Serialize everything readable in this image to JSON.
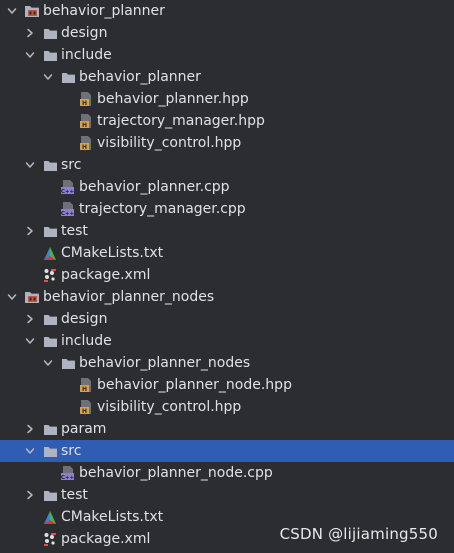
{
  "tree": [
    {
      "label": "behavior_planner",
      "kind": "module",
      "depth": 0,
      "chevron": "down",
      "icon": "module-folder-icon"
    },
    {
      "label": "design",
      "kind": "folder",
      "depth": 1,
      "chevron": "right",
      "icon": "folder-icon"
    },
    {
      "label": "include",
      "kind": "folder",
      "depth": 1,
      "chevron": "down",
      "icon": "folder-icon"
    },
    {
      "label": "behavior_planner",
      "kind": "folder",
      "depth": 2,
      "chevron": "down",
      "icon": "folder-icon"
    },
    {
      "label": "behavior_planner.hpp",
      "kind": "hpp",
      "depth": 3,
      "chevron": "none",
      "icon": "cpp-header-file-icon"
    },
    {
      "label": "trajectory_manager.hpp",
      "kind": "hpp",
      "depth": 3,
      "chevron": "none",
      "icon": "cpp-header-file-icon"
    },
    {
      "label": "visibility_control.hpp",
      "kind": "hpp",
      "depth": 3,
      "chevron": "none",
      "icon": "cpp-header-file-icon"
    },
    {
      "label": "src",
      "kind": "folder",
      "depth": 1,
      "chevron": "down",
      "icon": "folder-icon"
    },
    {
      "label": "behavior_planner.cpp",
      "kind": "cpp",
      "depth": 2,
      "chevron": "none",
      "icon": "cpp-source-file-icon"
    },
    {
      "label": "trajectory_manager.cpp",
      "kind": "cpp",
      "depth": 2,
      "chevron": "none",
      "icon": "cpp-source-file-icon"
    },
    {
      "label": "test",
      "kind": "folder",
      "depth": 1,
      "chevron": "right",
      "icon": "folder-icon"
    },
    {
      "label": "CMakeLists.txt",
      "kind": "cmake",
      "depth": 1,
      "chevron": "none",
      "icon": "cmake-file-icon"
    },
    {
      "label": "package.xml",
      "kind": "xml",
      "depth": 1,
      "chevron": "none",
      "icon": "ros-package-xml-icon"
    },
    {
      "label": "behavior_planner_nodes",
      "kind": "module",
      "depth": 0,
      "chevron": "down",
      "icon": "module-folder-icon"
    },
    {
      "label": "design",
      "kind": "folder",
      "depth": 1,
      "chevron": "right",
      "icon": "folder-icon"
    },
    {
      "label": "include",
      "kind": "folder",
      "depth": 1,
      "chevron": "down",
      "icon": "folder-icon"
    },
    {
      "label": "behavior_planner_nodes",
      "kind": "folder",
      "depth": 2,
      "chevron": "down",
      "icon": "folder-icon"
    },
    {
      "label": "behavior_planner_node.hpp",
      "kind": "hpp",
      "depth": 3,
      "chevron": "none",
      "icon": "cpp-header-file-icon"
    },
    {
      "label": "visibility_control.hpp",
      "kind": "hpp",
      "depth": 3,
      "chevron": "none",
      "icon": "cpp-header-file-icon"
    },
    {
      "label": "param",
      "kind": "folder",
      "depth": 1,
      "chevron": "right",
      "icon": "folder-icon"
    },
    {
      "label": "src",
      "kind": "folder",
      "depth": 1,
      "chevron": "down",
      "icon": "folder-icon",
      "selected": true
    },
    {
      "label": "behavior_planner_node.cpp",
      "kind": "cpp",
      "depth": 2,
      "chevron": "none",
      "icon": "cpp-source-file-icon"
    },
    {
      "label": "test",
      "kind": "folder",
      "depth": 1,
      "chevron": "right",
      "icon": "folder-icon"
    },
    {
      "label": "CMakeLists.txt",
      "kind": "cmake",
      "depth": 1,
      "chevron": "none",
      "icon": "cmake-file-icon"
    },
    {
      "label": "package.xml",
      "kind": "xml",
      "depth": 1,
      "chevron": "none",
      "icon": "ros-package-xml-icon"
    }
  ],
  "watermark": "CSDN @lijiaming550",
  "colors": {
    "background": "#2b2d30",
    "selection": "#2f5db3",
    "text": "#dfe1e5",
    "folder": "#aeb3c2",
    "header_icon": "#d9a343",
    "source_icon": "#8f7fd1"
  }
}
